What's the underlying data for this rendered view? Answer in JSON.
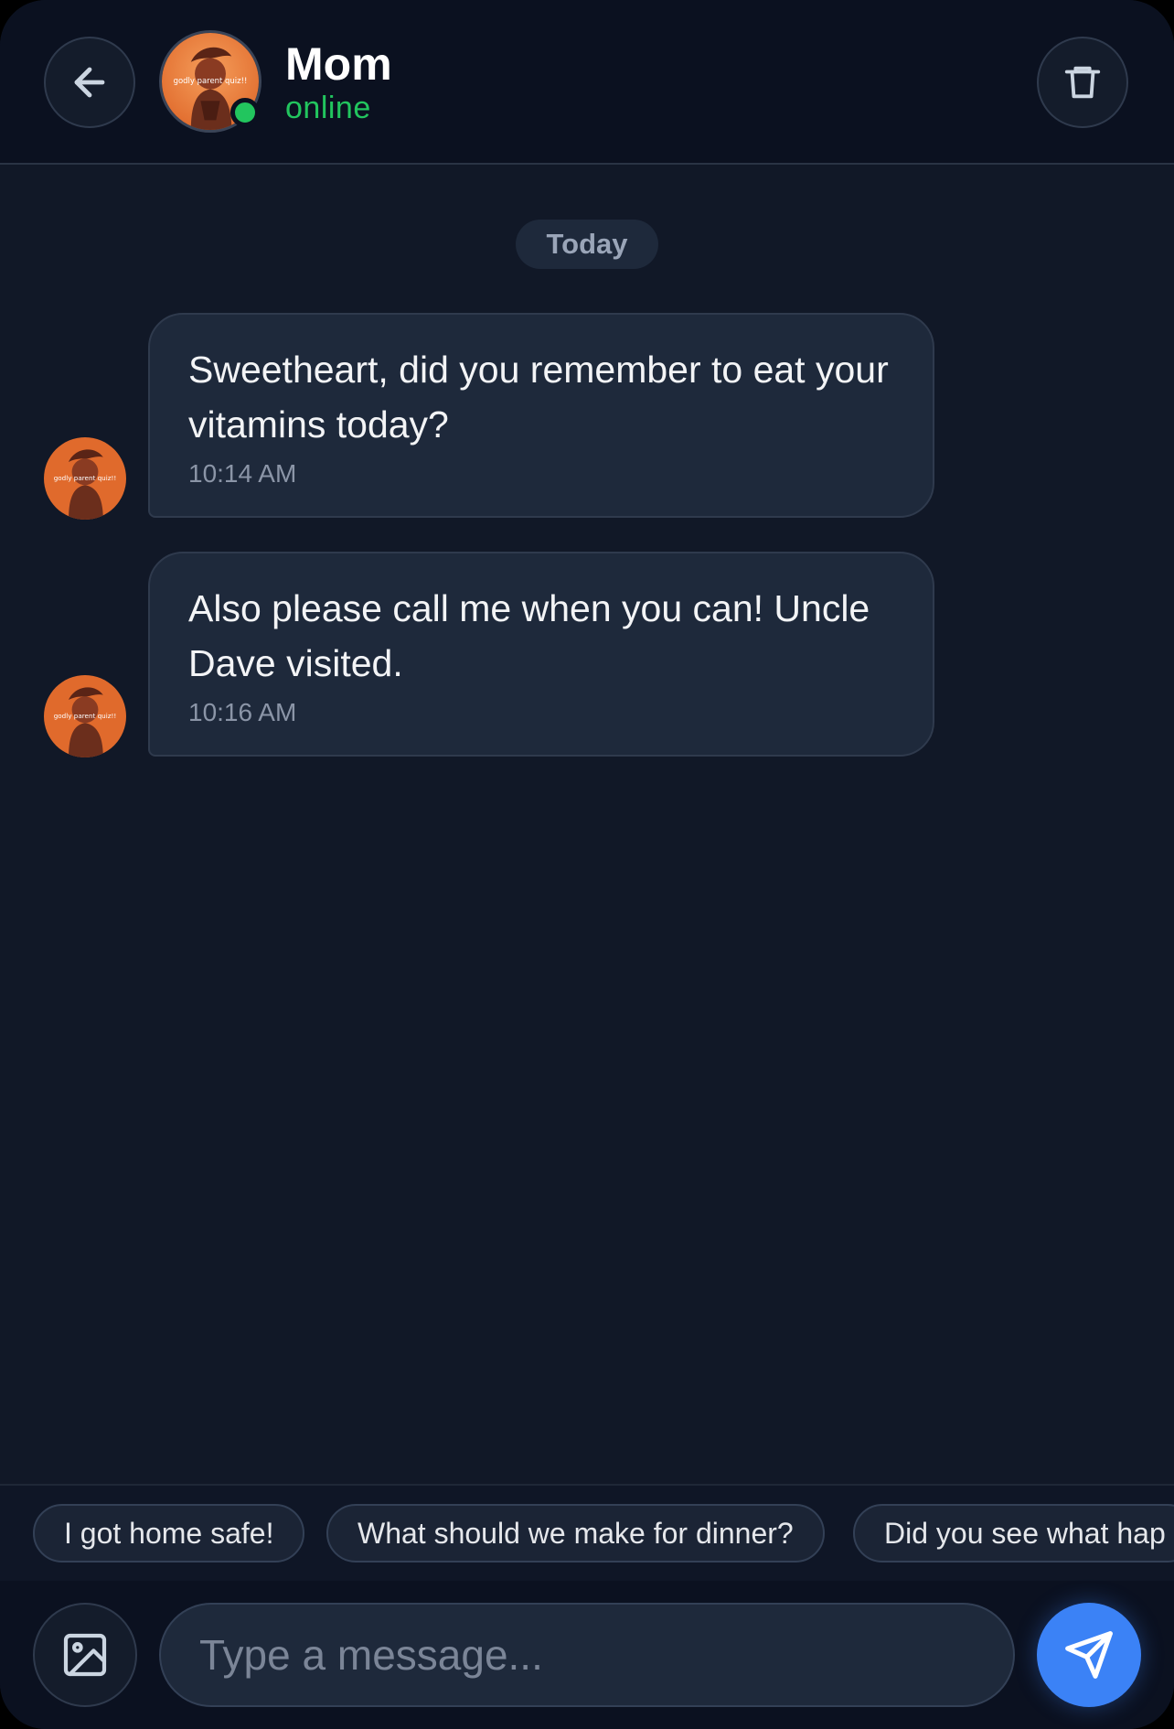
{
  "header": {
    "contact_name": "Mom",
    "status": "online",
    "back_icon": "arrow-left-icon",
    "delete_icon": "trash-icon",
    "status_color": "#22c55e"
  },
  "day_separator": "Today",
  "messages": [
    {
      "text": "Sweetheart, did you remember to eat your vitamins today?",
      "time": "10:14 AM",
      "sender": "Mom"
    },
    {
      "text": "Also please call me when you can! Uncle Dave visited.",
      "time": "10:16 AM",
      "sender": "Mom"
    }
  ],
  "avatar_caption": "godly parent quiz!!",
  "quick_replies": [
    "I got home safe!",
    "What should we make for dinner?",
    "Did you see what hap"
  ],
  "composer": {
    "placeholder": "Type a message...",
    "image_icon": "image-icon",
    "send_icon": "send-icon"
  },
  "colors": {
    "background": "#111827",
    "bubble": "#1e293b",
    "accent": "#3b82f6"
  }
}
